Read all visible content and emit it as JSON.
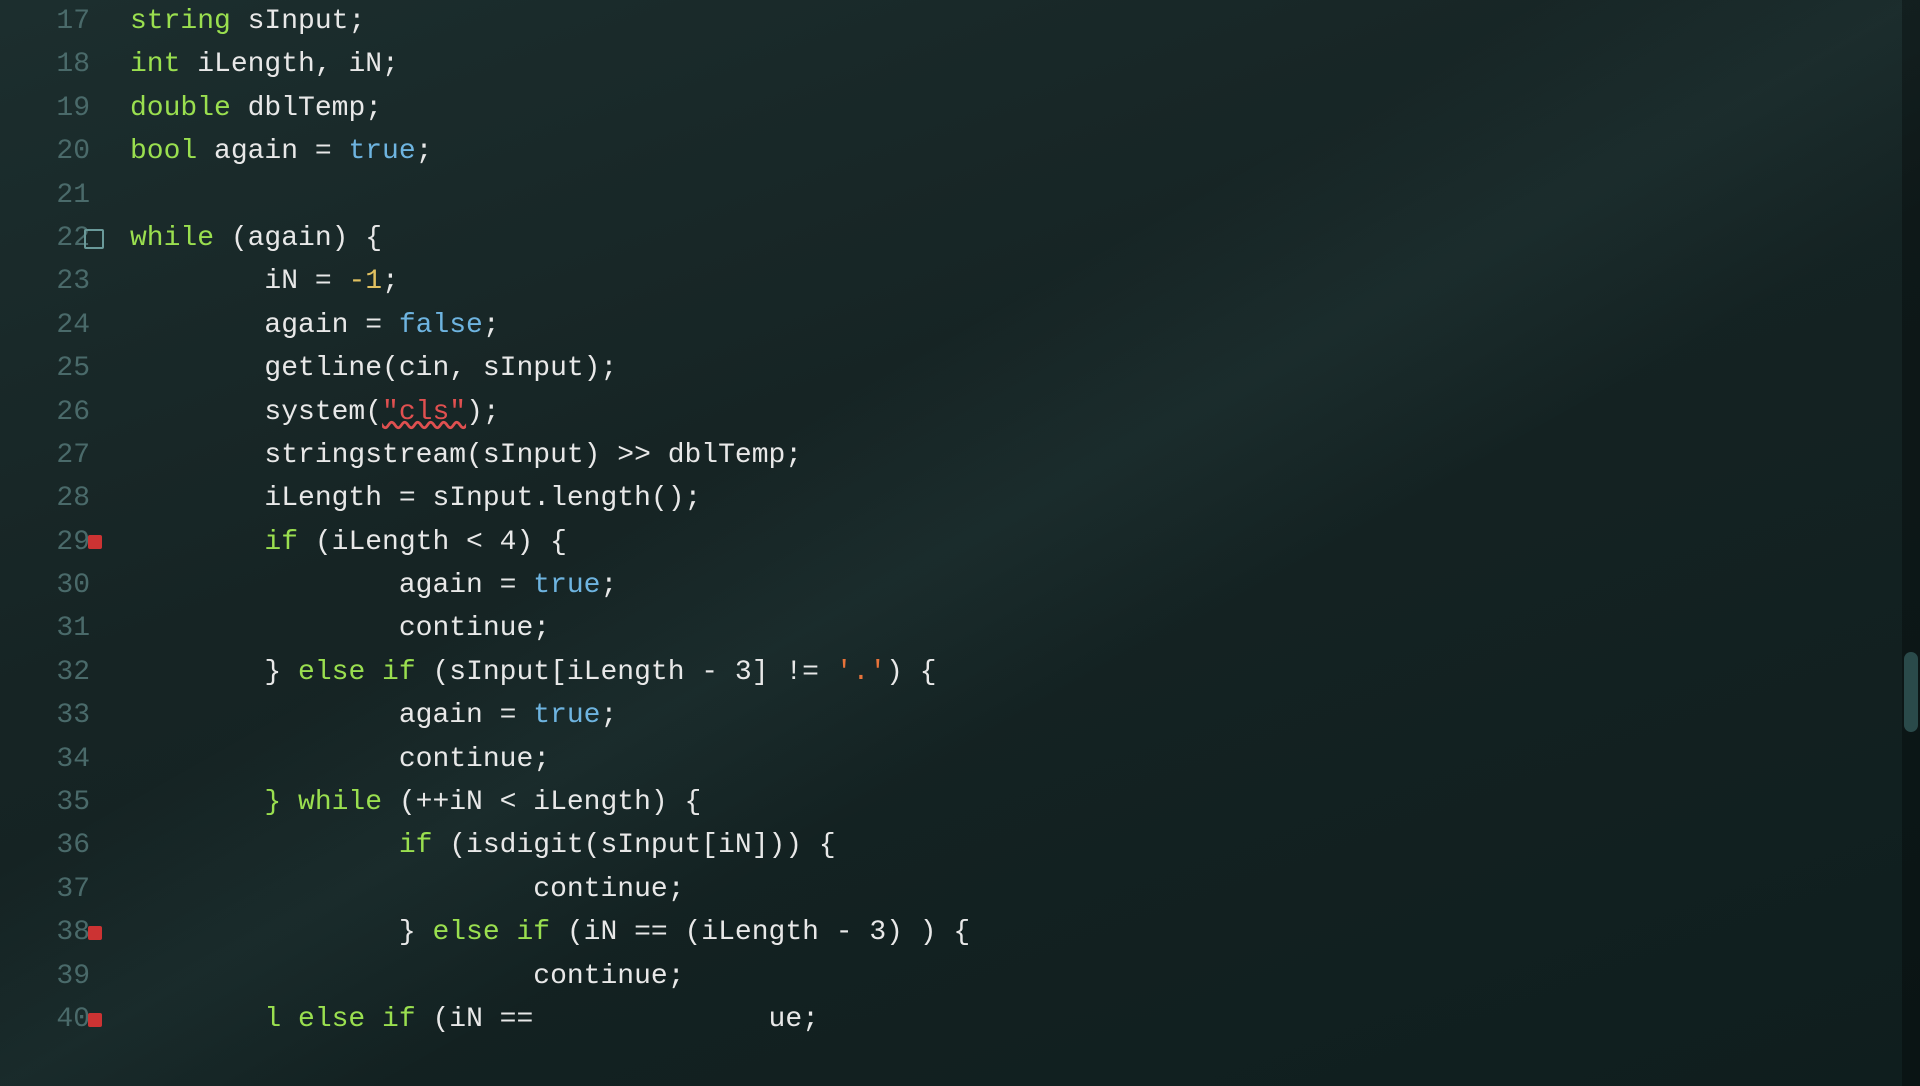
{
  "editor": {
    "theme": "dark",
    "fontSize": 28,
    "lines": [
      {
        "num": "17",
        "marker": false,
        "expand": false,
        "code": [
          {
            "t": "type",
            "v": "string"
          },
          {
            "t": "var",
            "v": " sInput;"
          }
        ]
      },
      {
        "num": "18",
        "marker": false,
        "expand": false,
        "code": [
          {
            "t": "kw",
            "v": "int"
          },
          {
            "t": "var",
            "v": " iLength, iN;"
          }
        ]
      },
      {
        "num": "19",
        "marker": false,
        "expand": false,
        "code": [
          {
            "t": "kw",
            "v": "double"
          },
          {
            "t": "var",
            "v": " dblTemp;"
          }
        ]
      },
      {
        "num": "20",
        "marker": false,
        "expand": false,
        "code": [
          {
            "t": "kw",
            "v": "bool"
          },
          {
            "t": "var",
            "v": " again = "
          },
          {
            "t": "bool",
            "v": "true"
          },
          {
            "t": "var",
            "v": ";"
          }
        ]
      },
      {
        "num": "21",
        "marker": false,
        "expand": false,
        "code": []
      },
      {
        "num": "22",
        "marker": false,
        "expand": true,
        "code": [
          {
            "t": "kw",
            "v": "while"
          },
          {
            "t": "var",
            "v": " (again) {"
          }
        ]
      },
      {
        "num": "23",
        "marker": false,
        "expand": false,
        "code": [
          {
            "t": "var",
            "v": "        iN = "
          },
          {
            "t": "num",
            "v": "-1"
          },
          {
            "t": "var",
            "v": ";"
          }
        ]
      },
      {
        "num": "24",
        "marker": false,
        "expand": false,
        "code": [
          {
            "t": "var",
            "v": "        again = "
          },
          {
            "t": "bool",
            "v": "false"
          },
          {
            "t": "var",
            "v": ";"
          }
        ]
      },
      {
        "num": "25",
        "marker": false,
        "expand": false,
        "code": [
          {
            "t": "var",
            "v": "        getline(cin, sInput);"
          }
        ]
      },
      {
        "num": "26",
        "marker": false,
        "expand": false,
        "code": [
          {
            "t": "var",
            "v": "        system("
          },
          {
            "t": "str-red",
            "v": "\"cls\""
          },
          {
            "t": "var",
            "v": ");"
          }
        ]
      },
      {
        "num": "27",
        "marker": false,
        "expand": false,
        "code": [
          {
            "t": "var",
            "v": "        stringstream(sInput) >> dblTemp;"
          }
        ]
      },
      {
        "num": "28",
        "marker": false,
        "expand": false,
        "code": [
          {
            "t": "var",
            "v": "        iLength = sInput.length();"
          }
        ]
      },
      {
        "num": "29",
        "marker": true,
        "expand": false,
        "code": [
          {
            "t": "kw",
            "v": "        if"
          },
          {
            "t": "var",
            "v": " (iLength < 4) {"
          }
        ]
      },
      {
        "num": "30",
        "marker": false,
        "expand": false,
        "code": [
          {
            "t": "var",
            "v": "                again = "
          },
          {
            "t": "bool",
            "v": "true"
          },
          {
            "t": "var",
            "v": ";"
          }
        ]
      },
      {
        "num": "31",
        "marker": false,
        "expand": false,
        "code": [
          {
            "t": "var",
            "v": "                continue;"
          }
        ]
      },
      {
        "num": "32",
        "marker": false,
        "expand": false,
        "code": [
          {
            "t": "var",
            "v": "        } "
          },
          {
            "t": "kw",
            "v": "else if"
          },
          {
            "t": "var",
            "v": " (sInput[iLength - 3] != "
          },
          {
            "t": "str",
            "v": "'.'"
          },
          {
            "t": "var",
            "v": ") {"
          }
        ]
      },
      {
        "num": "33",
        "marker": false,
        "expand": false,
        "code": [
          {
            "t": "var",
            "v": "                again = "
          },
          {
            "t": "bool",
            "v": "true"
          },
          {
            "t": "var",
            "v": ";"
          }
        ]
      },
      {
        "num": "34",
        "marker": false,
        "expand": false,
        "code": [
          {
            "t": "var",
            "v": "                continue;"
          }
        ]
      },
      {
        "num": "35",
        "marker": false,
        "expand": false,
        "code": [
          {
            "t": "kw",
            "v": "        } while"
          },
          {
            "t": "var",
            "v": " (++iN < iLength) {"
          }
        ]
      },
      {
        "num": "36",
        "marker": false,
        "expand": false,
        "code": [
          {
            "t": "kw",
            "v": "                if"
          },
          {
            "t": "var",
            "v": " (isdigit(sInput[iN])) {"
          }
        ]
      },
      {
        "num": "37",
        "marker": false,
        "expand": false,
        "code": [
          {
            "t": "var",
            "v": "                        continue;"
          }
        ]
      },
      {
        "num": "38",
        "marker": true,
        "expand": false,
        "code": [
          {
            "t": "kw",
            "v": "                } else if"
          },
          {
            "t": "var",
            "v": " (iN == (iLength - 3) ) {"
          }
        ]
      },
      {
        "num": "39",
        "marker": false,
        "expand": false,
        "code": [
          {
            "t": "var",
            "v": "                        continue;"
          }
        ]
      },
      {
        "num": "40",
        "marker": false,
        "expand": false,
        "code": [
          {
            "t": "kw",
            "v": "        l else if"
          },
          {
            "t": "var",
            "v": " (iN ==              ue;"
          }
        ]
      }
    ]
  }
}
